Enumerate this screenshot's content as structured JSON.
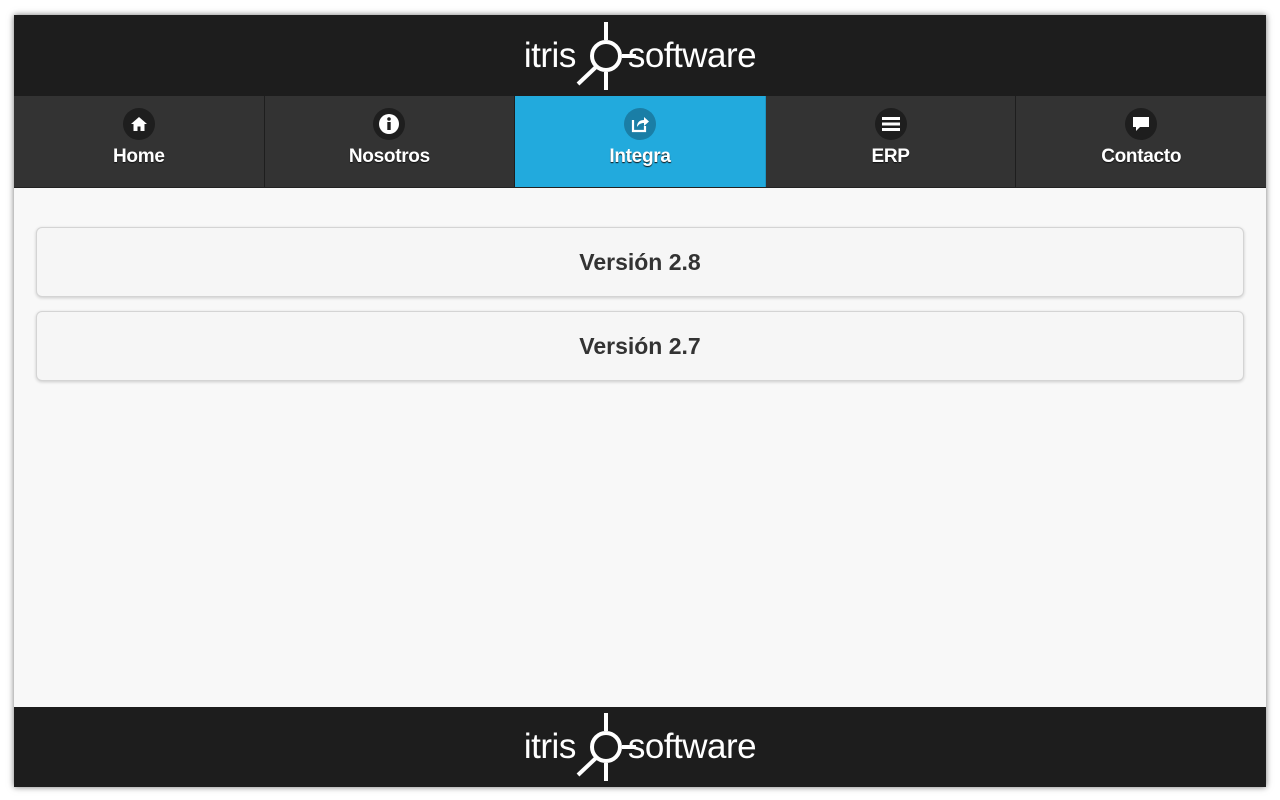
{
  "brand": {
    "logo_left": "itris",
    "logo_right": "software"
  },
  "nav": {
    "items": [
      {
        "label": "Home",
        "icon": "home-icon"
      },
      {
        "label": "Nosotros",
        "icon": "info-icon"
      },
      {
        "label": "Integra",
        "icon": "share-icon",
        "active": true
      },
      {
        "label": "ERP",
        "icon": "menu-icon"
      },
      {
        "label": "Contacto",
        "icon": "chat-icon"
      }
    ]
  },
  "main": {
    "versions": [
      {
        "label": "Versión 2.8"
      },
      {
        "label": "Versión 2.7"
      }
    ]
  },
  "colors": {
    "header_bg": "#1d1d1d",
    "nav_bg": "#333333",
    "nav_active": "#22aadd",
    "content_bg": "#f8f8f8"
  }
}
